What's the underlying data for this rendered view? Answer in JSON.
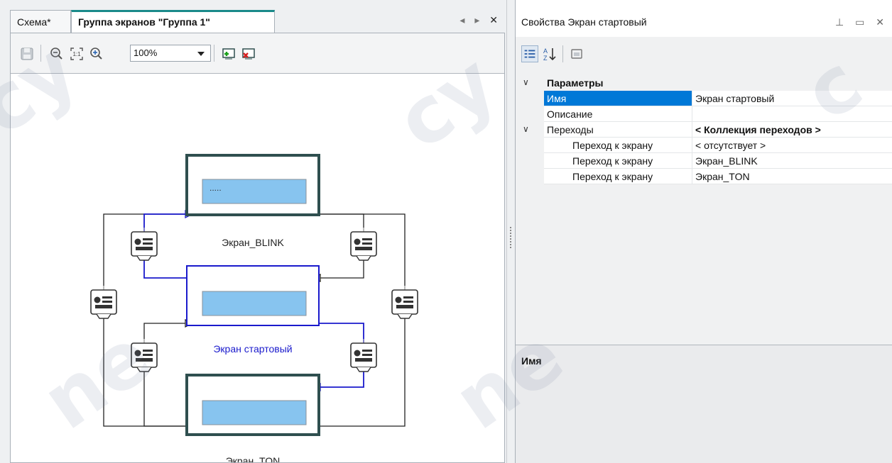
{
  "editor": {
    "tabs": [
      {
        "label": "Схема*"
      },
      {
        "label": "Группа экранов \"Группа 1\""
      }
    ],
    "zoom": "100%",
    "diagram": {
      "screens": [
        {
          "name": "Экран_BLINK",
          "selected": false,
          "display_text": "....."
        },
        {
          "name": "Экран стартовый",
          "selected": true
        },
        {
          "name": "Экран_TON",
          "selected": false
        }
      ],
      "colors": {
        "selected": "#1a1acc",
        "normal": "#222222",
        "frame": "#2f4f4f",
        "field": "#87c4ef"
      }
    }
  },
  "properties": {
    "title": "Свойства Экран стартовый",
    "category": "Параметры",
    "rows": {
      "name": {
        "label": "Имя",
        "value": "Экран стартовый"
      },
      "description": {
        "label": "Описание",
        "value": ""
      },
      "transitions": {
        "label": "Переходы",
        "value": "< Коллекция переходов >"
      },
      "t1": {
        "label": "Переход к экрану",
        "value": "< отсутствует >"
      },
      "t2": {
        "label": "Переход к экрану",
        "value": "Экран_BLINK"
      },
      "t3": {
        "label": "Переход к экрану",
        "value": "Экран_TON"
      }
    },
    "description_panel_title": "Имя"
  },
  "watermark": "сyпepoйс",
  "accent_color": "#0078d7"
}
